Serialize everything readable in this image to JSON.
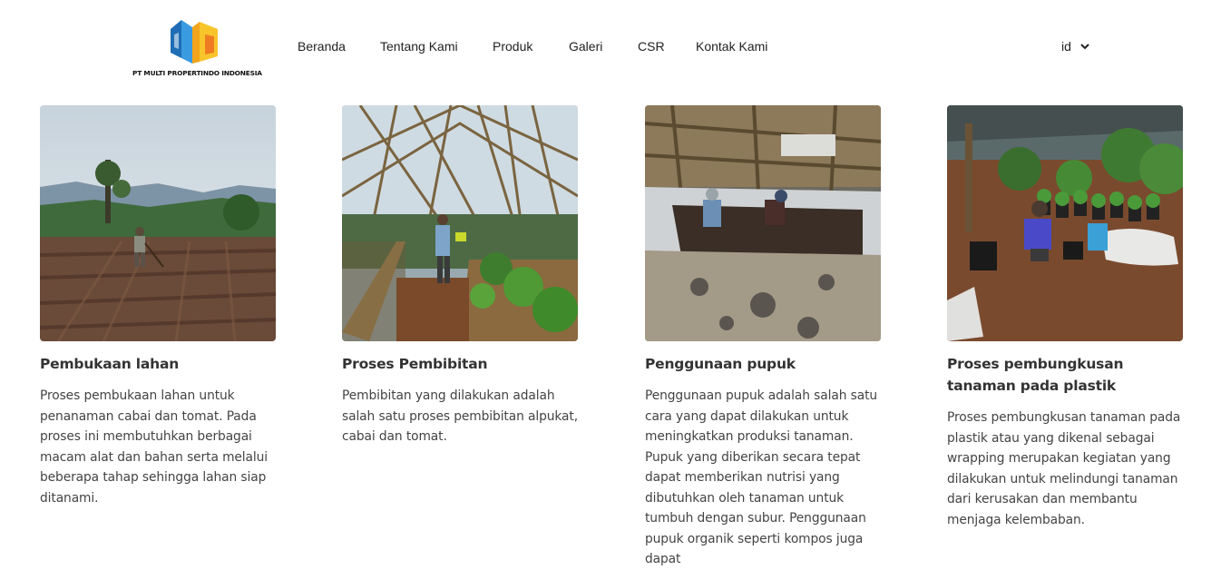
{
  "brand": {
    "company_name": "PT MULTI PROPERTINDO INDONESIA",
    "logo_icon": "building-logo-icon",
    "colors": {
      "blue": "#2a7fc8",
      "yellow": "#f4b71a",
      "orange": "#ef7b22"
    }
  },
  "nav": {
    "items": [
      {
        "label": "Beranda"
      },
      {
        "label": "Tentang Kami"
      },
      {
        "label": "Produk"
      },
      {
        "label": "Galeri"
      },
      {
        "label": "CSR"
      },
      {
        "label": "Kontak Kami"
      }
    ],
    "language": {
      "selected": "id",
      "icon": "chevron-down-icon"
    }
  },
  "gallery": {
    "cards": [
      {
        "title": "Pembukaan lahan",
        "description": "Proses pembukaan lahan untuk penanaman cabai dan tomat. Pada proses ini membutuhkan berbagai macam alat dan bahan serta melalui beberapa tahap sehingga lahan siap ditanami."
      },
      {
        "title": "Proses Pembibitan",
        "description": "Pembibitan yang dilakukan adalah salah satu proses pembibitan alpukat, cabai dan tomat."
      },
      {
        "title": "Penggunaan pupuk",
        "description": "Penggunaan pupuk adalah salah satu cara yang dapat dilakukan untuk meningkatkan produksi tanaman. Pupuk yang diberikan secara tepat dapat memberikan nutrisi yang dibutuhkan oleh tanaman untuk tumbuh dengan subur. Penggunaan pupuk organik seperti kompos juga dapat"
      },
      {
        "title": "Proses pembungkusan tanaman pada plastik",
        "description": "Proses pembungkusan tanaman pada plastik atau yang dikenal sebagai wrapping merupakan kegiatan yang dilakukan untuk melindungi tanaman dari kerusakan dan membantu menjaga kelembaban."
      }
    ]
  }
}
